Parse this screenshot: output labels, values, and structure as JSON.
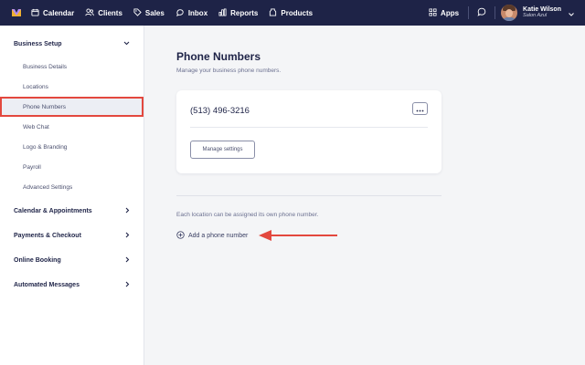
{
  "nav": {
    "items": [
      {
        "label": "Calendar",
        "icon": "calendar-icon"
      },
      {
        "label": "Clients",
        "icon": "clients-icon"
      },
      {
        "label": "Sales",
        "icon": "sales-tag-icon"
      },
      {
        "label": "Inbox",
        "icon": "inbox-icon"
      },
      {
        "label": "Reports",
        "icon": "reports-icon"
      },
      {
        "label": "Products",
        "icon": "products-icon"
      }
    ],
    "apps_label": "Apps",
    "user": {
      "name": "Katie Wilson",
      "location": "Salon Azul"
    }
  },
  "sidebar": {
    "business_setup": {
      "label": "Business Setup",
      "items": [
        {
          "label": "Business Details"
        },
        {
          "label": "Locations"
        },
        {
          "label": "Phone Numbers",
          "active": true
        },
        {
          "label": "Web Chat"
        },
        {
          "label": "Logo & Branding"
        },
        {
          "label": "Payroll"
        },
        {
          "label": "Advanced Settings"
        }
      ]
    },
    "sections": [
      {
        "label": "Calendar & Appointments"
      },
      {
        "label": "Payments & Checkout"
      },
      {
        "label": "Online Booking"
      },
      {
        "label": "Automated Messages"
      }
    ]
  },
  "main": {
    "title": "Phone Numbers",
    "subtitle": "Manage your business phone numbers.",
    "card": {
      "phone": "(513) 496-3216",
      "manage_label": "Manage settings"
    },
    "info_text": "Each location can be assigned its own phone number.",
    "add_label": "Add a phone number"
  },
  "colors": {
    "nav_bg": "#1e2347",
    "accent_red": "#e3483e",
    "page_bg": "#f4f5f7",
    "active_item_bg": "#eceef4"
  }
}
